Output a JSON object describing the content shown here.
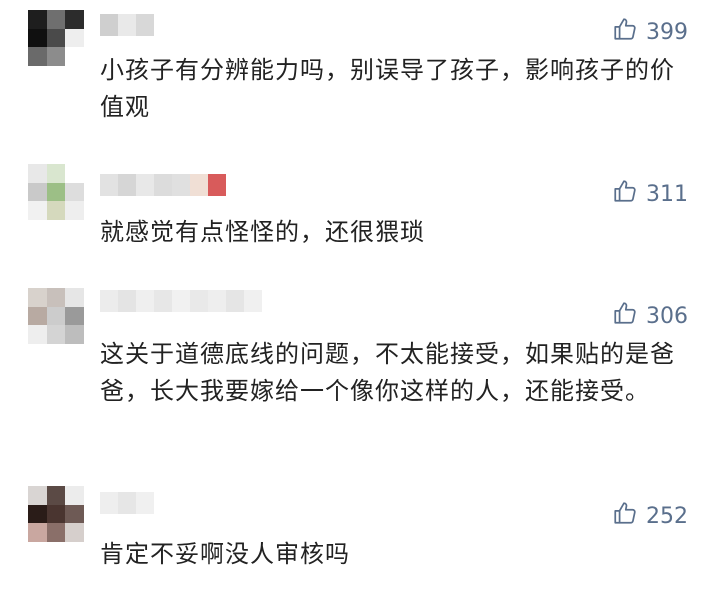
{
  "comments": [
    {
      "like_icon": "thumbs-up-icon",
      "likes": "399",
      "text": "小孩子有分辨能力吗，别误导了孩子，影响孩子的价值观"
    },
    {
      "like_icon": "thumbs-up-icon",
      "likes": "311",
      "text": "就感觉有点怪怪的，还很猥琐"
    },
    {
      "like_icon": "thumbs-up-icon",
      "likes": "306",
      "text": "这关于道德底线的问题，不太能接受，如果贴的是爸爸，长大我要嫁给一个像你这样的人，还能接受。"
    },
    {
      "like_icon": "thumbs-up-icon",
      "likes": "252",
      "text": "肯定不妥啊没人审核吗"
    }
  ],
  "colors": {
    "like_color": "#5a6f8c",
    "text_color": "#222222"
  }
}
